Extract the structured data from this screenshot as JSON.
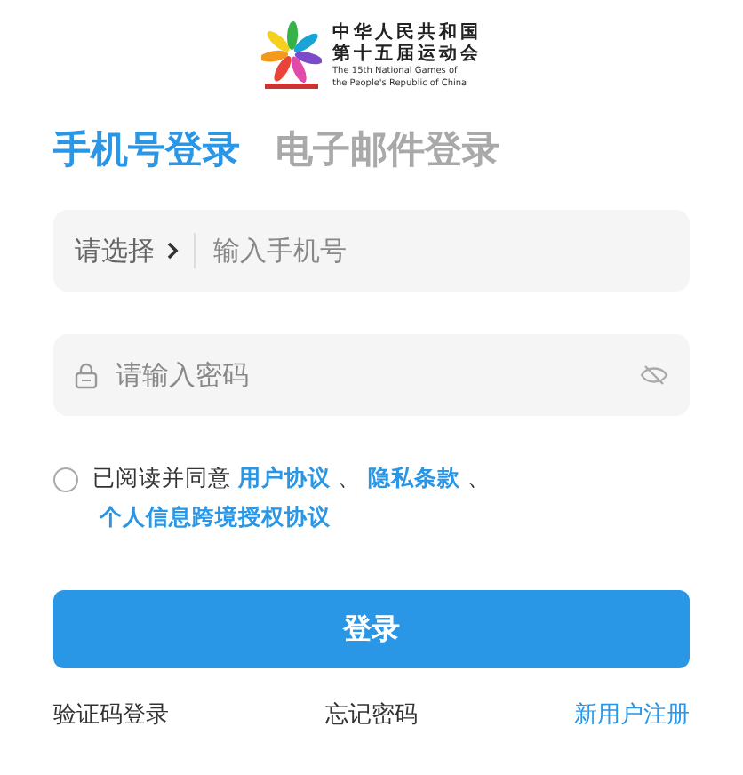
{
  "logo": {
    "title_lines": [
      "中华人民共和国",
      "第十五届运动会"
    ],
    "english_lines": [
      "The 15th National Games of",
      "the People's Republic of China"
    ]
  },
  "tabs": [
    {
      "label": "手机号登录",
      "selected": true
    },
    {
      "label": "电子邮件登录",
      "selected": false
    }
  ],
  "phone_field": {
    "region_select": "请选择",
    "placeholder": "输入手机号"
  },
  "password_field": {
    "placeholder": "请输入密码"
  },
  "agreement": {
    "checked": false,
    "parts": [
      {
        "kind": "text",
        "text": "已阅读并同意"
      },
      {
        "kind": "link",
        "text": "用户协议"
      },
      {
        "kind": "text",
        "text": "、"
      },
      {
        "kind": "link",
        "text": "隐私条款"
      },
      {
        "kind": "text",
        "text": "、"
      },
      {
        "kind": "link",
        "text": "个人信息跨境授权协议"
      }
    ]
  },
  "login_button": "登录",
  "bottom_links": [
    {
      "label": "验证码登录",
      "kind": "plain"
    },
    {
      "label": "忘记密码",
      "kind": "plain"
    },
    {
      "label": "新用户注册",
      "kind": "accent"
    }
  ]
}
